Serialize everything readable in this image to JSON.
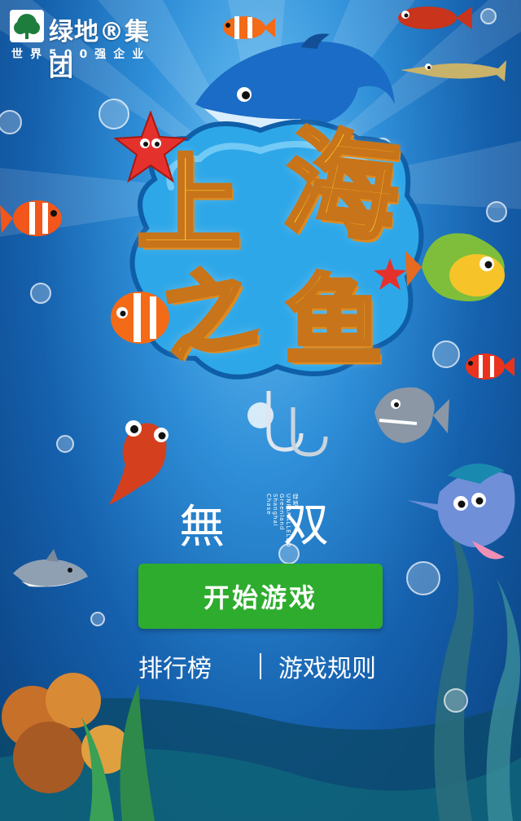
{
  "logo": {
    "name": "绿地®集团",
    "subtitle": "世界500强企业"
  },
  "title": {
    "chars": [
      "上",
      "海",
      "之",
      "鱼"
    ]
  },
  "brand": {
    "left": "無",
    "right": "双",
    "vertical_text": "绿地 UNPARALLELED Greenland Shanghai Chase"
  },
  "buttons": {
    "start": "开始游戏",
    "leaderboard": "排行榜",
    "rules": "游戏规则"
  },
  "colors": {
    "start_button": "#2eac2e",
    "title_fill": "#ffcb2f"
  }
}
